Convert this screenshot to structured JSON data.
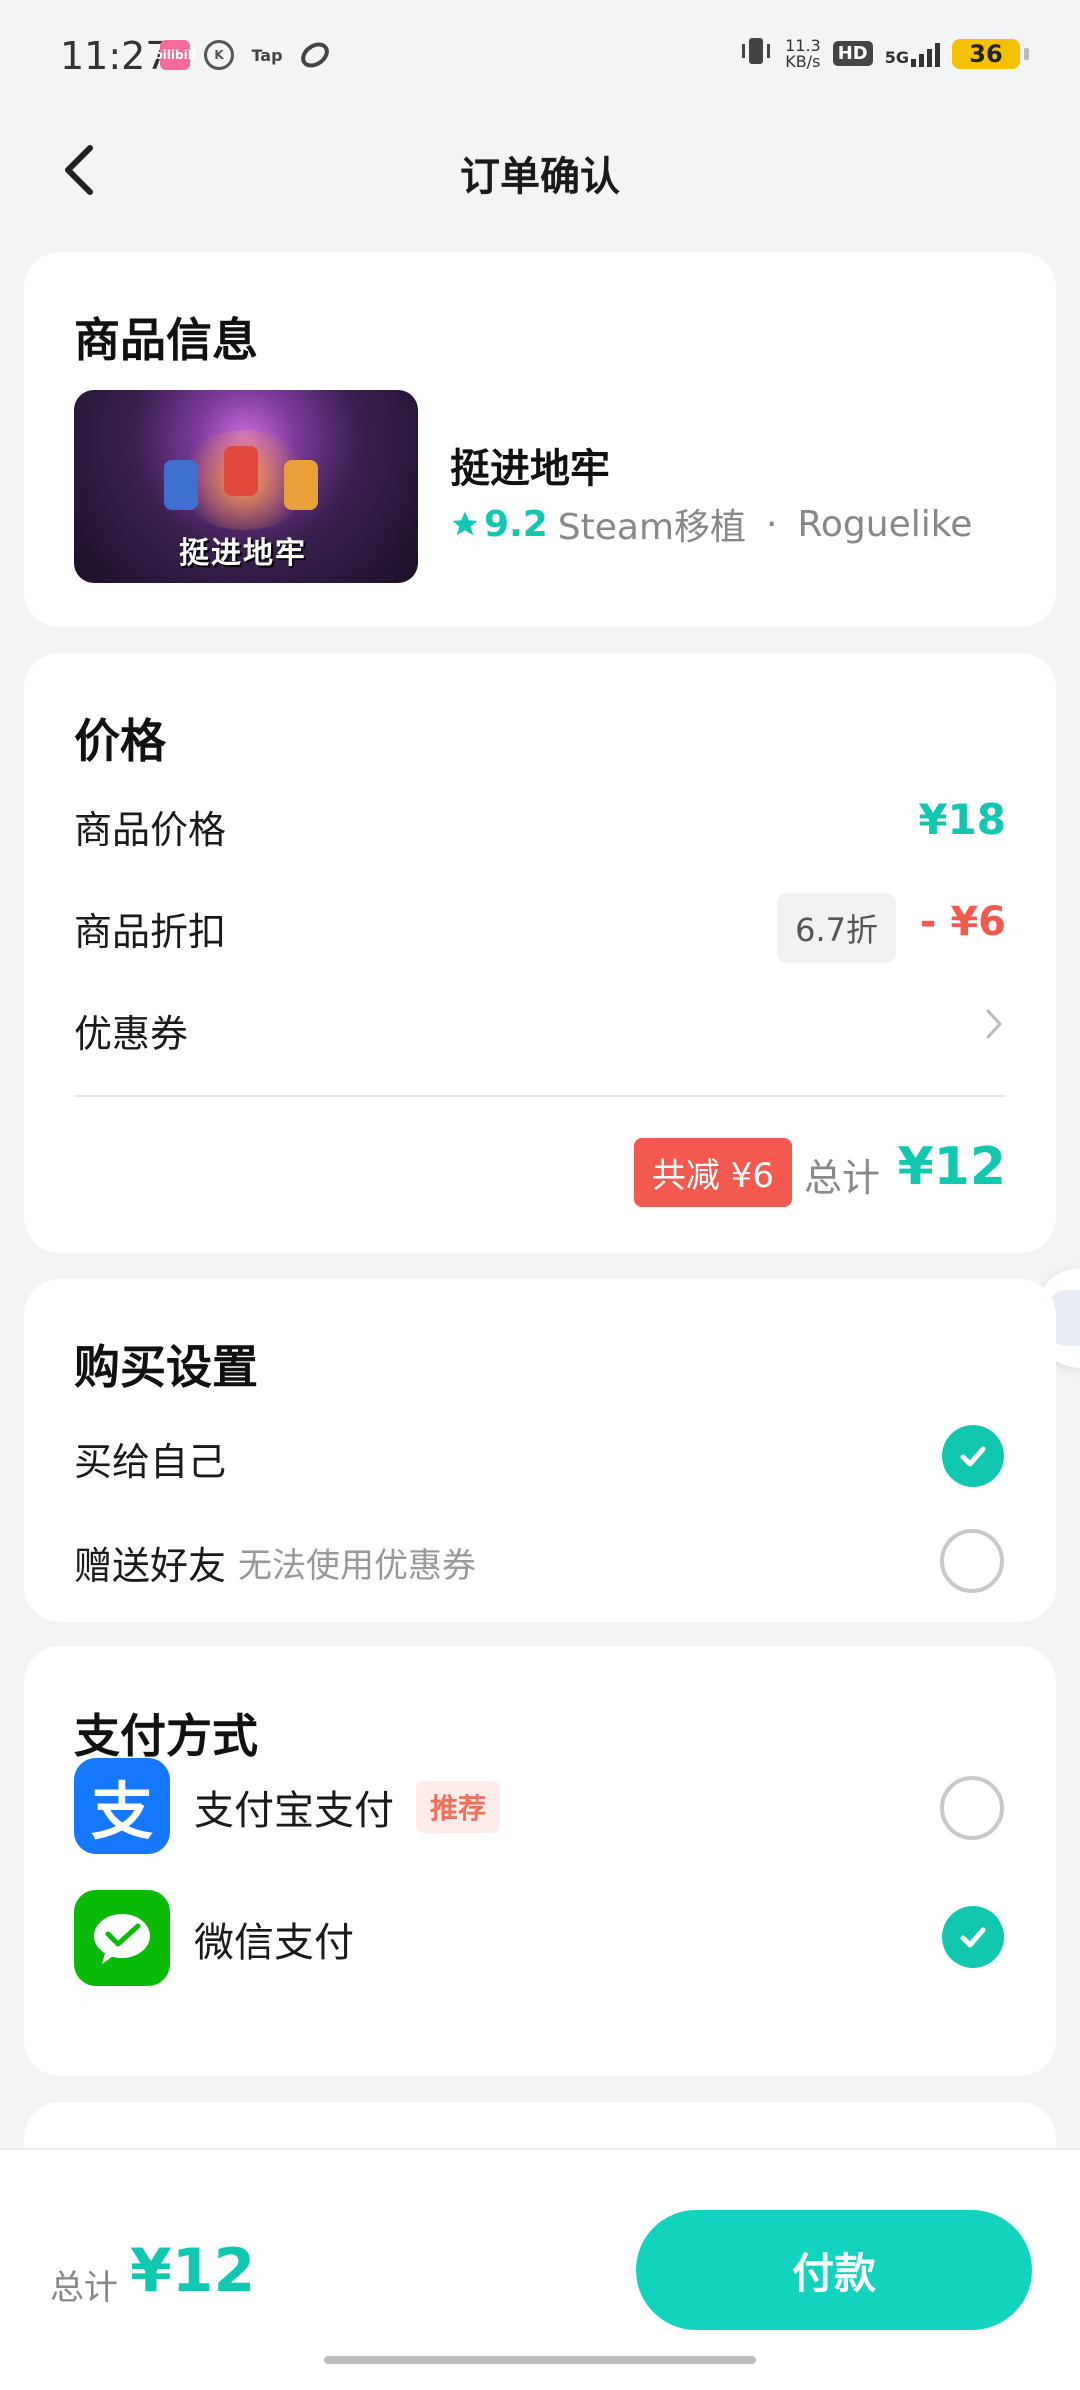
{
  "status_bar": {
    "time": "11:27",
    "net_speed_value": "11.3",
    "net_speed_unit": "KB/s",
    "hd_label": "HD",
    "network": "5G",
    "battery": "36",
    "app_icons": [
      "bilibili-icon",
      "k-icon",
      "tap-icon",
      "loop-icon"
    ],
    "app_icon_labels": [
      "bilibili",
      "K",
      "Tap"
    ]
  },
  "nav": {
    "title": "订单确认",
    "back_icon": "chevron-left-icon"
  },
  "product": {
    "section_title": "商品信息",
    "cover_text": "挺进地牢",
    "name": "挺进地牢",
    "rating": "9.2",
    "platform": "Steam移植",
    "separator": "·",
    "genre": "Roguelike"
  },
  "price": {
    "section_title": "价格",
    "item_price_label": "商品价格",
    "item_price_value": "¥18",
    "discount_label": "商品折扣",
    "discount_rate": "6.7折",
    "discount_value": "- ¥6",
    "coupon_label": "优惠券",
    "save_badge": "共减 ¥6",
    "total_label": "总计",
    "total_value": "¥12"
  },
  "purchase": {
    "section_title": "购买设置",
    "self_label": "买给自己",
    "self_selected": true,
    "gift_label": "赠送好友",
    "gift_note": "无法使用优惠券",
    "gift_selected": false
  },
  "payment": {
    "section_title": "支付方式",
    "alipay_label": "支付宝支付",
    "alipay_tag": "推荐",
    "alipay_glyph": "支",
    "alipay_selected": false,
    "wechat_label": "微信支付",
    "wechat_selected": true,
    "colors": {
      "alipay": "#1677ff",
      "wechat": "#09bb07"
    }
  },
  "bottom": {
    "total_label": "总计",
    "total_value": "¥12",
    "pay_button": "付款"
  },
  "colors": {
    "accent": "#12c7b0",
    "danger": "#f35a4f",
    "background": "#f3f4f6"
  }
}
